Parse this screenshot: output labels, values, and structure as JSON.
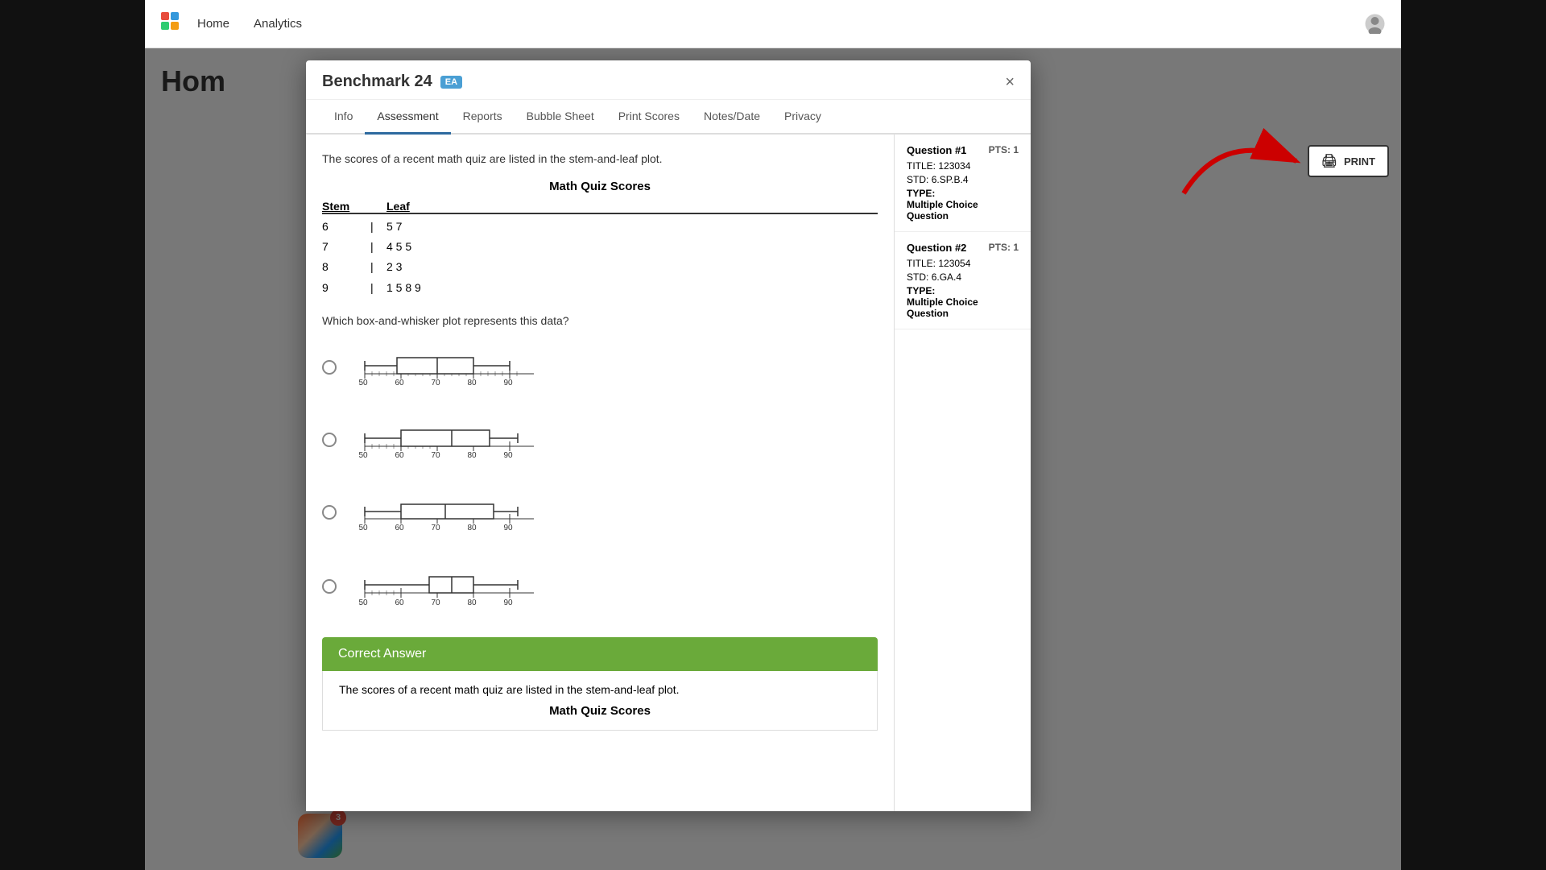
{
  "app": {
    "title": "Benchmark 24",
    "badge": "EA",
    "close_label": "×"
  },
  "nav": {
    "logo_label": "logo",
    "links": [
      {
        "label": "Home",
        "active": true
      },
      {
        "label": "Analytics"
      }
    ],
    "notification_count": "3"
  },
  "modal": {
    "tabs": [
      {
        "label": "Info",
        "active": false
      },
      {
        "label": "Assessment",
        "active": true
      },
      {
        "label": "Reports",
        "active": false
      },
      {
        "label": "Bubble Sheet",
        "active": false
      },
      {
        "label": "Print Scores",
        "active": false
      },
      {
        "label": "Notes/Date",
        "active": false
      },
      {
        "label": "Privacy",
        "active": false
      }
    ]
  },
  "question": {
    "intro": "The scores of a recent math quiz are listed in the stem-and-leaf plot.",
    "chart_title": "Math Quiz Scores",
    "stem_header": "Stem",
    "leaf_header": "Leaf",
    "rows": [
      {
        "stem": "6",
        "leaf": "5 7"
      },
      {
        "stem": "7",
        "leaf": "4 5 5"
      },
      {
        "stem": "8",
        "leaf": "2 3"
      },
      {
        "stem": "9",
        "leaf": "1 5 8 9"
      }
    ],
    "question_text": "Which box-and-whisker plot represents this data?"
  },
  "sidebar": {
    "questions": [
      {
        "num": "Question #1",
        "pts_label": "PTS:",
        "pts_value": "1",
        "title_label": "TITLE:",
        "title_value": "123034",
        "std_label": "STD:",
        "std_value": "6.SP.B.4",
        "type_label": "TYPE:",
        "type_value": "Multiple Choice Question"
      },
      {
        "num": "Question #2",
        "pts_label": "PTS:",
        "pts_value": "1",
        "title_label": "TITLE:",
        "title_value": "123054",
        "std_label": "STD:",
        "std_value": "6.GA.4",
        "type_label": "TYPE:",
        "type_value": "Multiple Choice Question"
      }
    ]
  },
  "correct_answer": {
    "header": "Correct Answer",
    "intro": "The scores of a recent math quiz are listed in the stem-and-leaf plot.",
    "chart_title": "Math Quiz Scores"
  },
  "print_button": {
    "label": "PRINT",
    "icon": "🖨"
  },
  "home": {
    "title": "Hom"
  }
}
